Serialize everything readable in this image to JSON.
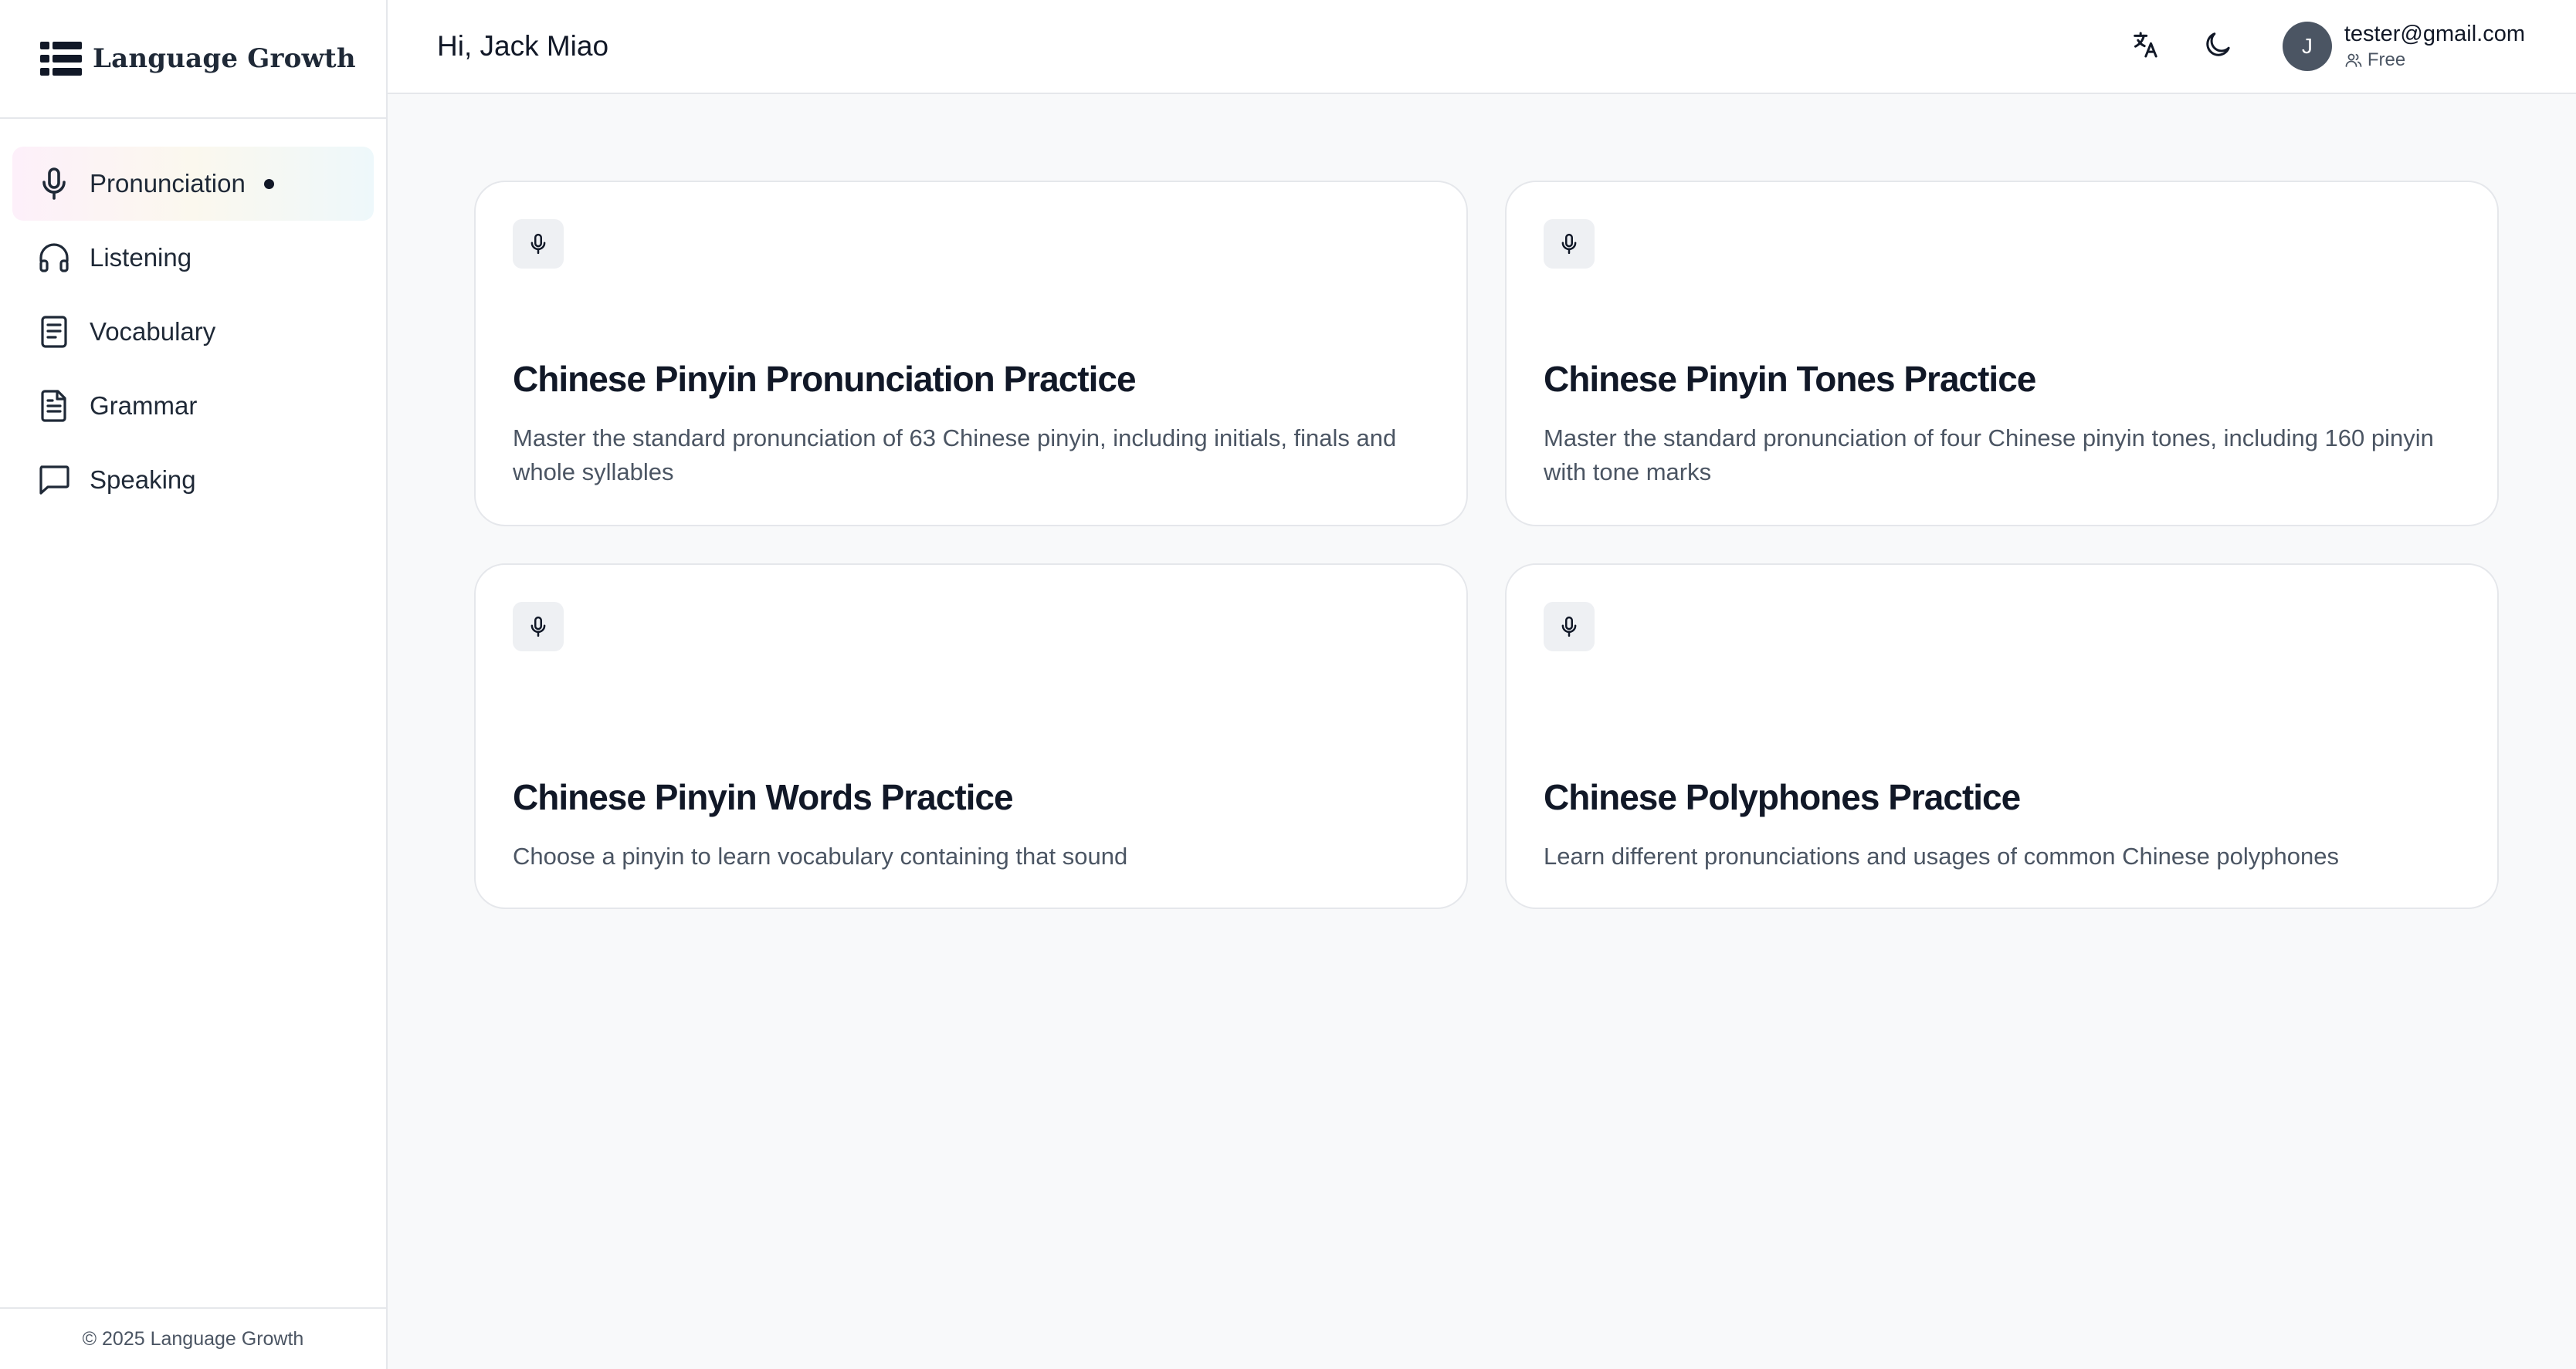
{
  "brand": {
    "name": "Language Growth"
  },
  "sidebar": {
    "items": [
      {
        "label": "Pronunciation",
        "icon": "microphone-icon",
        "active": true
      },
      {
        "label": "Listening",
        "icon": "headphones-icon",
        "active": false
      },
      {
        "label": "Vocabulary",
        "icon": "book-icon",
        "active": false
      },
      {
        "label": "Grammar",
        "icon": "document-icon",
        "active": false
      },
      {
        "label": "Speaking",
        "icon": "chat-bubble-icon",
        "active": false
      }
    ],
    "footer": "© 2025 Language Growth"
  },
  "header": {
    "greeting": "Hi, Jack Miao",
    "user": {
      "avatar_initial": "J",
      "email": "tester@gmail.com",
      "plan": "Free"
    }
  },
  "cards": [
    {
      "title": "Chinese Pinyin Pronunciation Practice",
      "description": "Master the standard pronunciation of 63 Chinese pinyin, including initials, finals and whole syllables",
      "icon": "microphone-icon"
    },
    {
      "title": "Chinese Pinyin Tones Practice",
      "description": "Master the standard pronunciation of four Chinese pinyin tones, including 160 pinyin with tone marks",
      "icon": "microphone-icon"
    },
    {
      "title": "Chinese Pinyin Words Practice",
      "description": "Choose a pinyin to learn vocabulary containing that sound",
      "icon": "microphone-icon"
    },
    {
      "title": "Chinese Polyphones Practice",
      "description": "Learn different pronunciations and usages of common Chinese polyphones",
      "icon": "microphone-icon"
    }
  ],
  "colors": {
    "background": "#f8f9fa",
    "surface": "#ffffff",
    "border": "#e5e7eb",
    "text": "#111827",
    "muted_text": "#4b5563",
    "avatar": "#4b5563"
  }
}
